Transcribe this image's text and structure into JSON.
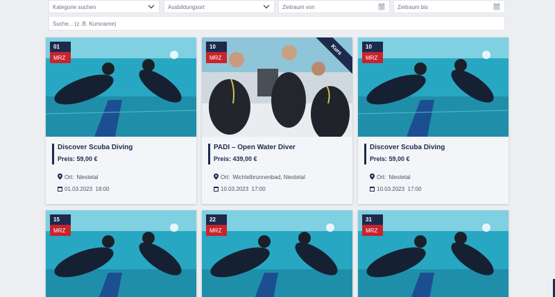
{
  "filters": {
    "category_placeholder": "Kategorie suchen",
    "location_placeholder": "Ausbildungsort",
    "date_from_placeholder": "Zeitraum von",
    "date_to_placeholder": "Zeitraum bis",
    "search_placeholder": "Suche... (z. B. Kursname)"
  },
  "colors": {
    "navy": "#1d2a4c",
    "red": "#c8242d",
    "pool": "#28a7c2"
  },
  "icons": {
    "chevron": "chevron-down-icon",
    "calendar": "calendar-icon",
    "pin": "map-pin-icon",
    "date": "calendar-small-icon"
  },
  "cards": [
    {
      "day": "01",
      "month": "MRZ",
      "title": "Discover Scuba Diving",
      "price": "Preis: 59,00 €",
      "location_label": "Ort:",
      "location": "Niestetal",
      "date": "01.03.2023",
      "time": "18:00"
    },
    {
      "day": "10",
      "month": "MRZ",
      "ribbon": "Kurs",
      "title": "PADI – Open Water Diver",
      "price": "Preis: 439,00 €",
      "location_label": "Ort:",
      "location": "Wichtelbrunnenbad, Niestetal",
      "date": "10.03.2023",
      "time": "17:00"
    },
    {
      "day": "10",
      "month": "MRZ",
      "title": "Discover Scuba Diving",
      "price": "Preis: 59,00 €",
      "location_label": "Ort:",
      "location": "Niestetal",
      "date": "10.03.2023",
      "time": "17:00"
    },
    {
      "day": "15",
      "month": "MRZ"
    },
    {
      "day": "22",
      "month": "MRZ"
    },
    {
      "day": "31",
      "month": "MRZ"
    }
  ]
}
